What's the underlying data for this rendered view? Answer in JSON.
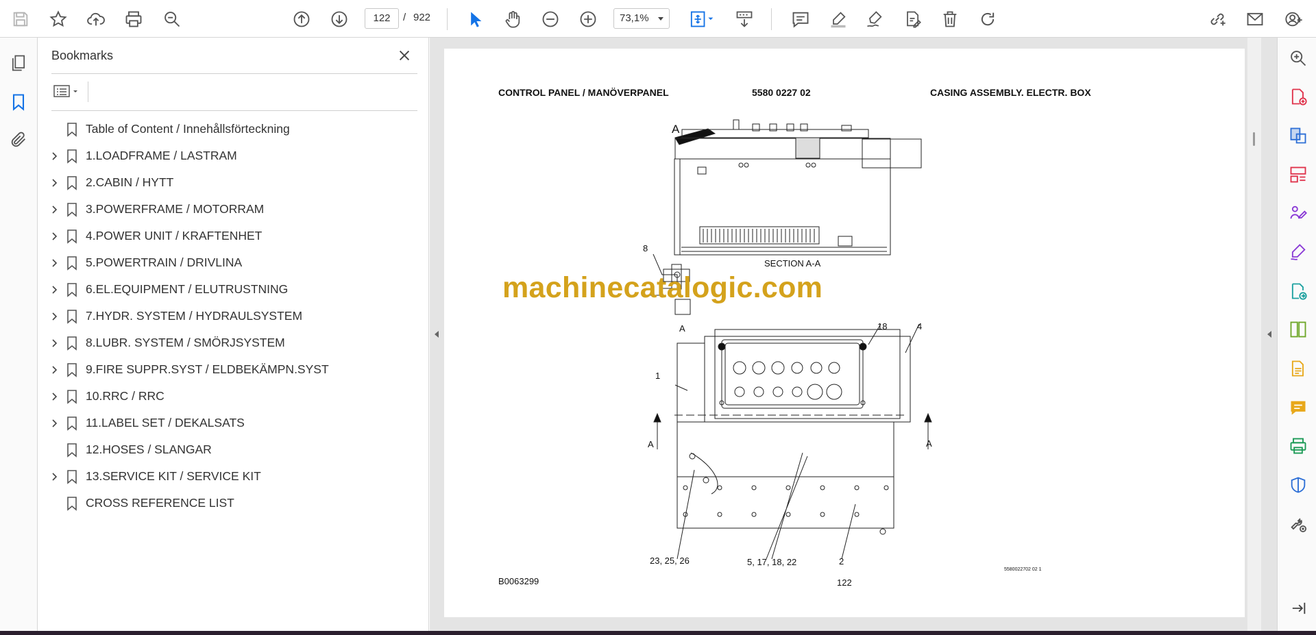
{
  "toolbar": {
    "page_current": "122",
    "page_separator": "/",
    "page_total": "922",
    "zoom": "73,1%"
  },
  "bookmarks": {
    "title": "Bookmarks",
    "items": [
      {
        "label": "Table of Content / Innehållsförteckning",
        "expandable": false
      },
      {
        "label": "1.LOADFRAME / LASTRAM",
        "expandable": true
      },
      {
        "label": "2.CABIN / HYTT",
        "expandable": true
      },
      {
        "label": "3.POWERFRAME / MOTORRAM",
        "expandable": true
      },
      {
        "label": "4.POWER UNIT / KRAFTENHET",
        "expandable": true
      },
      {
        "label": "5.POWERTRAIN / DRIVLINA",
        "expandable": true
      },
      {
        "label": "6.EL.EQUIPMENT / ELUTRUSTNING",
        "expandable": true
      },
      {
        "label": "7.HYDR. SYSTEM / HYDRAULSYSTEM",
        "expandable": true
      },
      {
        "label": "8.LUBR. SYSTEM / SMÖRJSYSTEM",
        "expandable": true
      },
      {
        "label": "9.FIRE SUPPR.SYST / ELDBEKÄMPN.SYST",
        "expandable": true
      },
      {
        "label": "10.RRC / RRC",
        "expandable": true
      },
      {
        "label": "11.LABEL SET / DEKALSATS",
        "expandable": true
      },
      {
        "label": "12.HOSES / SLANGAR",
        "expandable": false
      },
      {
        "label": "13.SERVICE KIT / SERVICE KIT",
        "expandable": true
      },
      {
        "label": "CROSS REFERENCE LIST",
        "expandable": false
      }
    ]
  },
  "document": {
    "header_left": "CONTROL PANEL / MANÖVERPANEL",
    "header_center": "5580 0227 02",
    "header_right": "CASING ASSEMBLY. ELECTR. BOX",
    "section_label": "SECTION A-A",
    "watermark": "machinecatalogic.com",
    "callouts": {
      "a_top": "A",
      "c8": "8",
      "c18": "18",
      "c4": "4",
      "c1": "1",
      "a_left": "A",
      "a_right": "A",
      "c23": "23, 25, 26",
      "c5": "5, 17, 18, 22",
      "c2": "2",
      "view_a": "A"
    },
    "footer_left": "B0063299",
    "footer_page": "122",
    "footer_small": "5580022702 02 1"
  },
  "colors": {
    "accent": "#1473e6",
    "watermark": "#d4a21c"
  }
}
